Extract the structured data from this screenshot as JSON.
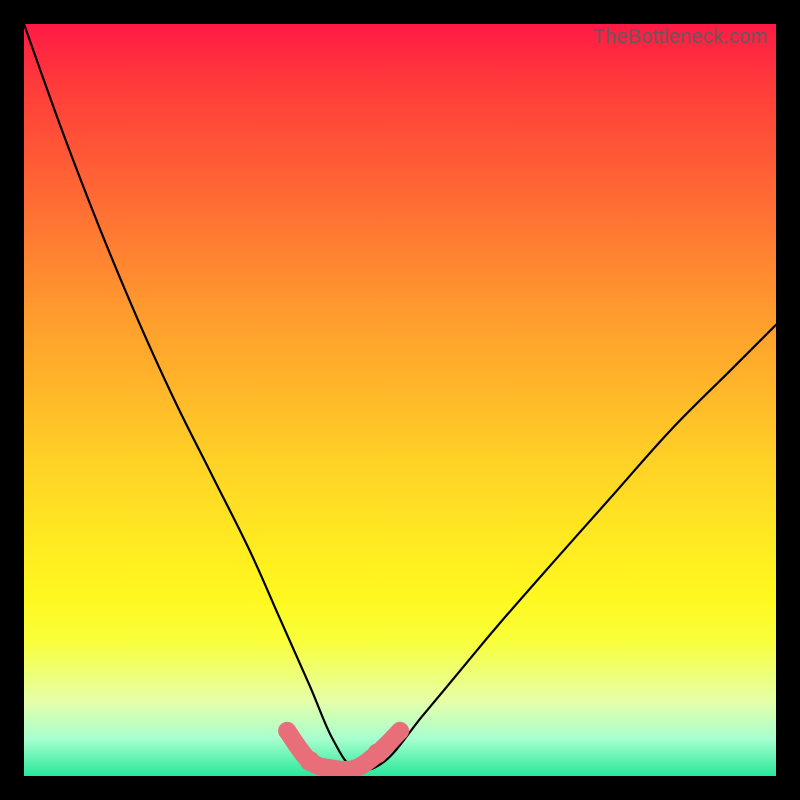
{
  "watermark": "TheBottleneck.com",
  "chart_data": {
    "type": "line",
    "title": "",
    "xlabel": "",
    "ylabel": "",
    "xlim": [
      0,
      100
    ],
    "ylim": [
      0,
      100
    ],
    "grid": false,
    "legend": false,
    "series": [
      {
        "name": "bottleneck-curve",
        "x": [
          0,
          5,
          10,
          15,
          20,
          25,
          30,
          34,
          38,
          41,
          44,
          48,
          53,
          58,
          63,
          70,
          78,
          86,
          94,
          100
        ],
        "y": [
          100,
          86,
          73,
          61,
          50,
          40,
          30,
          21,
          12,
          5,
          1,
          2,
          8,
          14,
          20,
          28,
          37,
          46,
          54,
          60
        ]
      }
    ],
    "highlight_band": {
      "name": "optimal-zone",
      "x": [
        35,
        38,
        41,
        44,
        47,
        50
      ],
      "y": [
        6,
        2,
        1,
        1,
        3,
        6
      ]
    },
    "background_gradient": {
      "top": "#ff1a45",
      "mid": "#ffe822",
      "bottom": "#28e89a"
    }
  }
}
